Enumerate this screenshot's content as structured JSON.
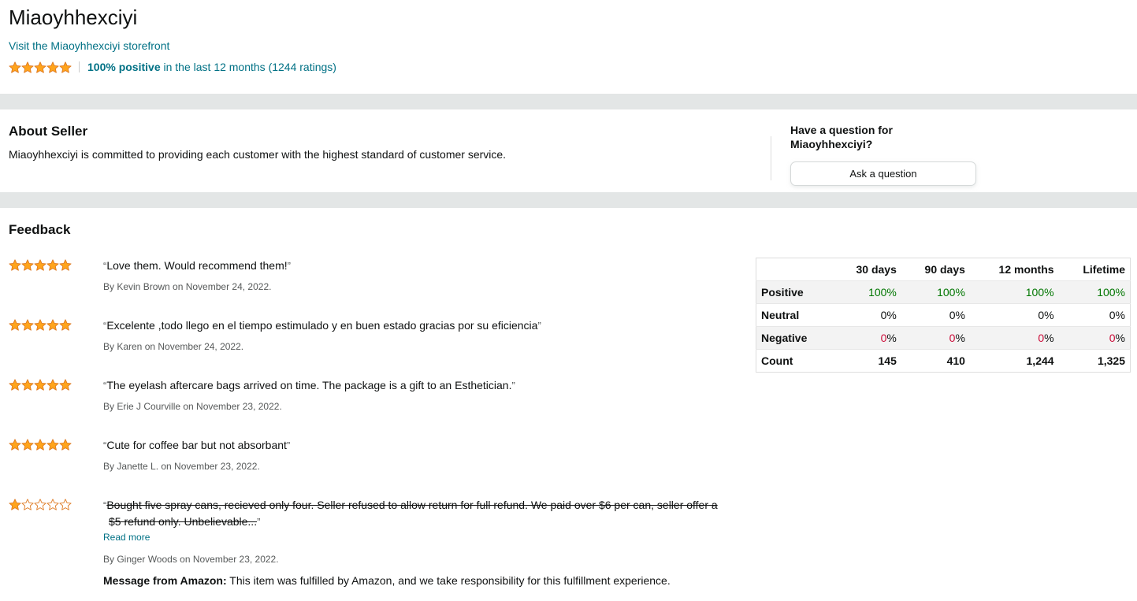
{
  "header": {
    "seller_name": "Miaoyhhexciyi",
    "storefront_link": "Visit the Miaoyhhexciyi storefront",
    "rating_stars": 5,
    "rating_positive": "100% positive",
    "rating_rest": " in the last 12 months (1244 ratings)"
  },
  "about": {
    "title": "About Seller",
    "text": "Miaoyhhexciyi is committed to providing each customer with the highest standard of customer service."
  },
  "question": {
    "title": "Have a question for Miaoyhhexciyi?",
    "button_label": "Ask a question"
  },
  "feedback": {
    "title": "Feedback",
    "reviews": [
      {
        "stars": 5,
        "text": "Love them. Would recommend them!",
        "byline": "By Kevin Brown on November 24, 2022."
      },
      {
        "stars": 5,
        "text": "Excelente ,todo llego en el tiempo estimulado y en buen estado gracias por su eficiencia",
        "byline": "By Karen on November 24, 2022."
      },
      {
        "stars": 5,
        "text": "The eyelash aftercare bags arrived on time. The package is a gift to an Esthetician.",
        "byline": "By Erie J Courville on November 23, 2022."
      },
      {
        "stars": 5,
        "text": "Cute for coffee bar but not absorbant",
        "byline": "By Janette L. on November 23, 2022."
      },
      {
        "stars": 1,
        "text_line1": "Bought five spray cans, recieved only four. Seller refused to allow return for full refund. We paid over $6 per can, seller offer a",
        "text_line2": "$5 refund only. Unbelievable...",
        "read_more": "Read more",
        "byline": "By Ginger Woods on November 23, 2022.",
        "amazon_label": "Message from Amazon:",
        "amazon_text": " This item was fulfilled by Amazon, and we take responsibility for this fulfillment experience."
      }
    ]
  },
  "stats": {
    "headers": [
      "30 days",
      "90 days",
      "12 months",
      "Lifetime"
    ],
    "rows": [
      {
        "label": "Positive",
        "values": [
          "100%",
          "100%",
          "100%",
          "100%"
        ]
      },
      {
        "label": "Neutral",
        "values": [
          "0%",
          "0%",
          "0%",
          "0%"
        ]
      },
      {
        "label": "Negative",
        "values": [
          "0%",
          "0%",
          "0%",
          "0%"
        ]
      },
      {
        "label": "Count",
        "values": [
          "145",
          "410",
          "1,244",
          "1,325"
        ]
      }
    ]
  },
  "colors": {
    "star_fill": "#ffa41c",
    "star_stroke": "#de7921",
    "link": "#007185",
    "positive": "#007600",
    "negative": "#cc0c39",
    "band": "#e3e6e6"
  }
}
